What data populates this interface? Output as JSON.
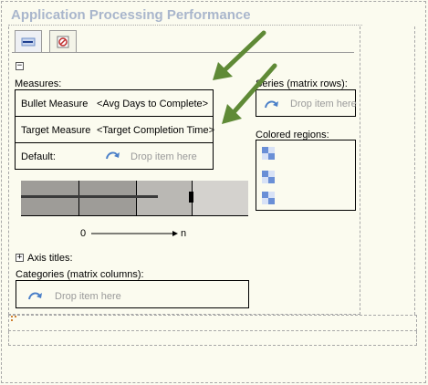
{
  "title": "Application Processing Performance",
  "tabs": [
    {
      "icon": "bullet-chart-icon",
      "active": true
    },
    {
      "icon": "no-filter-icon",
      "active": false
    }
  ],
  "collapse_symbol": "−",
  "measures": {
    "label": "Measures:",
    "rows": [
      {
        "name": "Bullet Measure",
        "value": "<Avg Days to Complete>"
      },
      {
        "name": "Target Measure",
        "value": "<Target Completion Time>"
      },
      {
        "name": "Default:",
        "drop": "Drop item here"
      }
    ]
  },
  "series": {
    "label": "Series (matrix rows):",
    "drop": "Drop item here"
  },
  "colored_regions": {
    "label": "Colored regions:",
    "items": [
      "region-1",
      "region-2",
      "region-3"
    ]
  },
  "scale": {
    "start": "0",
    "end": "n"
  },
  "axis_titles": {
    "expand_symbol": "+",
    "label": "Axis titles:"
  },
  "categories": {
    "label": "Categories (matrix columns):",
    "drop": "Drop item here"
  },
  "colors": {
    "title": "#a9b6cc",
    "drop_text": "#9a9a9a",
    "arrow_green": "#5f8a36",
    "drop_icon": "#4a7fc8"
  }
}
